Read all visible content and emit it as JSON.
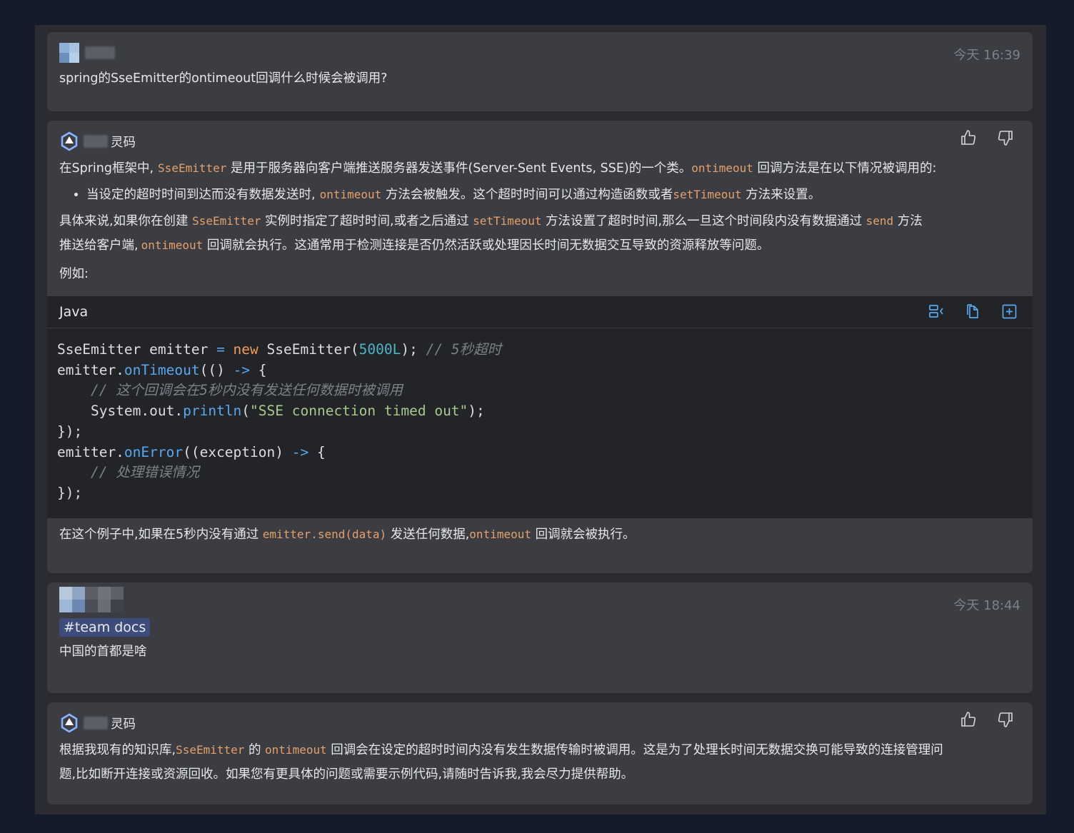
{
  "messages": {
    "m1": {
      "time": "今天 16:39",
      "text": "spring的SseEmitter的ontimeout回调什么时候会被调用?"
    },
    "m2": {
      "bot_name": "灵码",
      "p1a": "在Spring框架中,",
      "p1code": "SseEmitter",
      "p1b": " 是用于服务器向客户端推送服务器发送事件(Server-Sent Events, SSE)的一个类。",
      "p1code2": "ontimeout",
      "p1c": " 回调方法是在以下情况被调用的:",
      "b1a": "当设定的超时时间到达而没有数据发送时,",
      "b1code": "ontimeout",
      "b1b": " 方法会被触发。这个超时时间可以通过构造函数或者",
      "b1code2": "setTimeout",
      "b1c": " 方法来设置。",
      "p2a": "具体来说,如果你在创建 ",
      "p2code": "SseEmitter",
      "p2b": " 实例时指定了超时时间,或者之后通过 ",
      "p2code2": "setTimeout",
      "p2c": " 方法设置了超时时间,那么一旦这个时间段内没有数据通过 ",
      "p2code3": "send",
      "p2d": " 方法",
      "p3a": "推送给客户端,",
      "p3code": "ontimeout",
      "p3b": " 回调就会执行。这通常用于检测连接是否仍然活跃或处理因长时间无数据交互导致的资源释放等问题。",
      "p4": "例如:",
      "code_lang": "Java",
      "after_a": "在这个例子中,如果在5秒内没有通过 ",
      "after_code": "emitter.send(data)",
      "after_b": " 发送任何数据,",
      "after_code2": "ontimeout",
      "after_c": " 回调就会被执行。"
    },
    "m3": {
      "time": "今天 18:44",
      "tag": "#team docs",
      "text": "中国的首都是啥"
    },
    "m4": {
      "bot_name": "灵码",
      "l1a": "根据我现有的知识库,",
      "l1code": "SseEmitter",
      "l1b": " 的 ",
      "l1code2": "ontimeout",
      "l1c": " 回调会在设定的超时时间内没有发生数据传输时被调用。这是为了处理长时间无数据交换可能导致的连接管理问",
      "l2": "题,比如断开连接或资源回收。如果您有更具体的问题或需要示例代码,请随时告诉我,我会尽力提供帮助。"
    }
  },
  "code": {
    "l1_a": "SseEmitter emitter ",
    "l1_eq": "=",
    "l1_new": " new",
    "l1_b": " SseEmitter(",
    "l1_num": "5000L",
    "l1_c": "); ",
    "l1_cm": "// 5秒超时",
    "l2_a": "emitter.",
    "l2_fn": "onTimeout",
    "l2_b": "(() ",
    "l2_op": "->",
    "l2_c": " {",
    "l3_cm": "// 这个回调会在5秒内没有发送任何数据时被调用",
    "l4_a": "System.out.",
    "l4_fn": "println",
    "l4_b": "(",
    "l4_str": "\"SSE connection timed out\"",
    "l4_c": ");",
    "l5": "});",
    "l6_a": "emitter.",
    "l6_fn": "onError",
    "l6_b": "((exception) ",
    "l6_op": "->",
    "l6_c": " {",
    "l7_cm": "// 处理错误情况",
    "l8": "});"
  },
  "colors": {
    "background": "#141b2b",
    "card": "#3b3d43",
    "inline_code": "#e5a06a",
    "tag_bg": "#3d4c7a",
    "accent_blue": "#56a8f0"
  },
  "icons": [
    "thumbs-up-icon",
    "thumbs-down-icon",
    "insert-code-icon",
    "copy-icon",
    "new-file-icon",
    "lingma-logo-icon"
  ]
}
